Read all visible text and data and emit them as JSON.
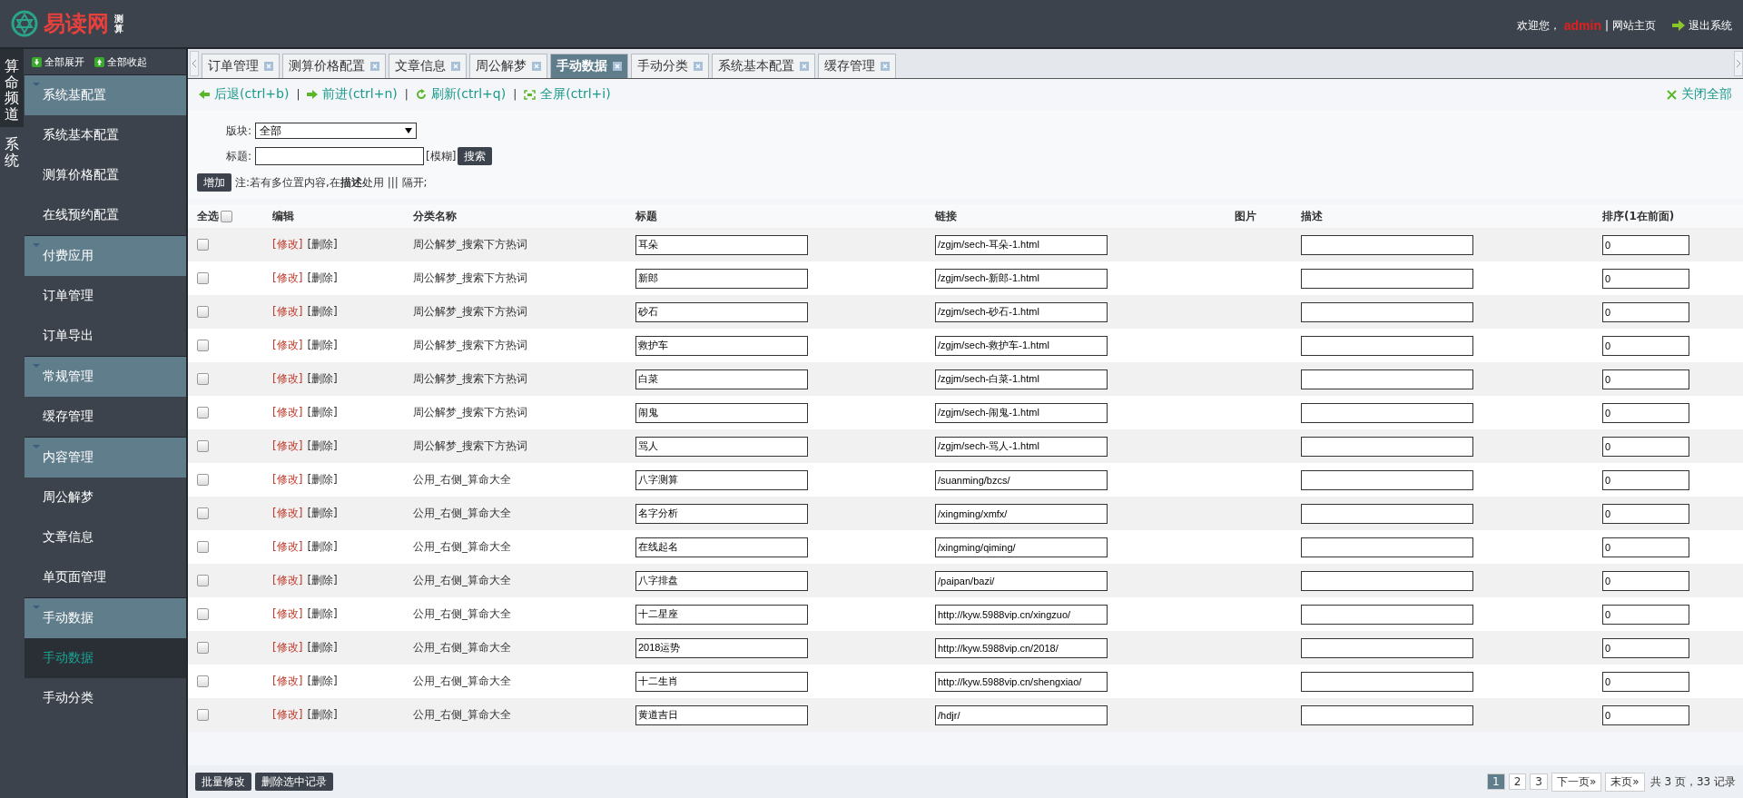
{
  "header": {
    "logo_text": "易读网",
    "logo_sub": "测算",
    "welcome": "欢迎您，",
    "user": "admin",
    "separator": "|",
    "home_link": "网站主页",
    "logout": "退出系统"
  },
  "channels": [
    {
      "label": "算命频道",
      "selected": true
    },
    {
      "label": "系统",
      "selected": false
    }
  ],
  "sidebar": {
    "expand_all": "全部展开",
    "collapse_all": "全部收起",
    "groups": [
      {
        "label": "系统基配置",
        "expanded": true,
        "children": [
          {
            "label": "系统基本配置",
            "selected": false
          },
          {
            "label": "测算价格配置",
            "selected": false
          },
          {
            "label": "在线预约配置",
            "selected": false
          }
        ]
      },
      {
        "label": "付费应用",
        "expanded": true,
        "children": [
          {
            "label": "订单管理",
            "selected": false
          },
          {
            "label": "订单导出",
            "selected": false
          }
        ]
      },
      {
        "label": "常规管理",
        "expanded": true,
        "children": [
          {
            "label": "缓存管理",
            "selected": false
          }
        ]
      },
      {
        "label": "内容管理",
        "expanded": true,
        "children": [
          {
            "label": "周公解梦",
            "selected": false
          },
          {
            "label": "文章信息",
            "selected": false
          },
          {
            "label": "单页面管理",
            "selected": false
          }
        ]
      },
      {
        "label": "手动数据",
        "expanded": true,
        "children": [
          {
            "label": "手动数据",
            "selected": true
          },
          {
            "label": "手动分类",
            "selected": false
          }
        ]
      }
    ]
  },
  "tabs": [
    {
      "label": "订单管理",
      "selected": false
    },
    {
      "label": "测算价格配置",
      "selected": false
    },
    {
      "label": "文章信息",
      "selected": false
    },
    {
      "label": "周公解梦",
      "selected": false
    },
    {
      "label": "手动数据",
      "selected": true
    },
    {
      "label": "手动分类",
      "selected": false
    },
    {
      "label": "系统基本配置",
      "selected": false
    },
    {
      "label": "缓存管理",
      "selected": false
    }
  ],
  "toolbar": {
    "back": "后退(ctrl+b)",
    "forward": "前进(ctrl+n)",
    "refresh": "刷新(ctrl+q)",
    "fullscreen": "全屏(ctrl+i)",
    "separator": "|",
    "close_all": "关闭全部"
  },
  "filters": {
    "block_label": "版块:",
    "block_value": "全部",
    "title_label": "标题:",
    "fuzzy": "[模糊]",
    "search": "搜索",
    "add": "增加",
    "note": "注:若有多位置内容,在**描述**处用 ||| 隔开;"
  },
  "table": {
    "select_all": "全选",
    "select_all_checked": false,
    "columns": [
      "编辑",
      "分类名称",
      "标题",
      "链接",
      "图片",
      "描述",
      "排序(1在前面)"
    ],
    "rows": [
      {
        "checked": false,
        "edit": "[修改]",
        "delete": "[删除]",
        "category": "周公解梦_搜索下方热词",
        "title": "耳朵",
        "link": "/zgjm/sech-耳朵-1.html",
        "order": "0"
      },
      {
        "checked": false,
        "edit": "[修改]",
        "delete": "[删除]",
        "category": "周公解梦_搜索下方热词",
        "title": "新郎",
        "link": "/zgjm/sech-新郎-1.html",
        "order": "0"
      },
      {
        "checked": false,
        "edit": "[修改]",
        "delete": "[删除]",
        "category": "周公解梦_搜索下方热词",
        "title": "砂石",
        "link": "/zgjm/sech-砂石-1.html",
        "order": "0"
      },
      {
        "checked": false,
        "edit": "[修改]",
        "delete": "[删除]",
        "category": "周公解梦_搜索下方热词",
        "title": "救护车",
        "link": "/zgjm/sech-救护车-1.html",
        "order": "0"
      },
      {
        "checked": false,
        "edit": "[修改]",
        "delete": "[删除]",
        "category": "周公解梦_搜索下方热词",
        "title": "白菜",
        "link": "/zgjm/sech-白菜-1.html",
        "order": "0"
      },
      {
        "checked": false,
        "edit": "[修改]",
        "delete": "[删除]",
        "category": "周公解梦_搜索下方热词",
        "title": "闹鬼",
        "link": "/zgjm/sech-闹鬼-1.html",
        "order": "0"
      },
      {
        "checked": false,
        "edit": "[修改]",
        "delete": "[删除]",
        "category": "周公解梦_搜索下方热词",
        "title": "骂人",
        "link": "/zgjm/sech-骂人-1.html",
        "order": "0"
      },
      {
        "checked": false,
        "edit": "[修改]",
        "delete": "[删除]",
        "category": "公用_右侧_算命大全",
        "title": "八字测算",
        "link": "/suanming/bzcs/",
        "order": "0"
      },
      {
        "checked": false,
        "edit": "[修改]",
        "delete": "[删除]",
        "category": "公用_右侧_算命大全",
        "title": "名字分析",
        "link": "/xingming/xmfx/",
        "order": "0"
      },
      {
        "checked": false,
        "edit": "[修改]",
        "delete": "[删除]",
        "category": "公用_右侧_算命大全",
        "title": "在线起名",
        "link": "/xingming/qiming/",
        "order": "0"
      },
      {
        "checked": false,
        "edit": "[修改]",
        "delete": "[删除]",
        "category": "公用_右侧_算命大全",
        "title": "八字排盘",
        "link": "/paipan/bazi/",
        "order": "0"
      },
      {
        "checked": false,
        "edit": "[修改]",
        "delete": "[删除]",
        "category": "公用_右侧_算命大全",
        "title": "十二星座",
        "link": "http://kyw.5988vip.cn/xingzuo/",
        "order": "0"
      },
      {
        "checked": false,
        "edit": "[修改]",
        "delete": "[删除]",
        "category": "公用_右侧_算命大全",
        "title": "2018运势",
        "link": "http://kyw.5988vip.cn/2018/",
        "order": "0"
      },
      {
        "checked": false,
        "edit": "[修改]",
        "delete": "[删除]",
        "category": "公用_右侧_算命大全",
        "title": "十二生肖",
        "link": "http://kyw.5988vip.cn/shengxiao/",
        "order": "0"
      },
      {
        "checked": false,
        "edit": "[修改]",
        "delete": "[删除]",
        "category": "公用_右侧_算命大全",
        "title": "黄道吉日",
        "link": "/hdjr/",
        "order": "0"
      }
    ]
  },
  "footer": {
    "batch_edit": "批量修改",
    "delete_selected": "删除选中记录",
    "pages": [
      {
        "label": "1",
        "selected": true
      },
      {
        "label": "2",
        "selected": false
      },
      {
        "label": "3",
        "selected": false
      }
    ],
    "next": "下一页»",
    "last": "末页»",
    "summary": "共 3 页，33 记录"
  }
}
